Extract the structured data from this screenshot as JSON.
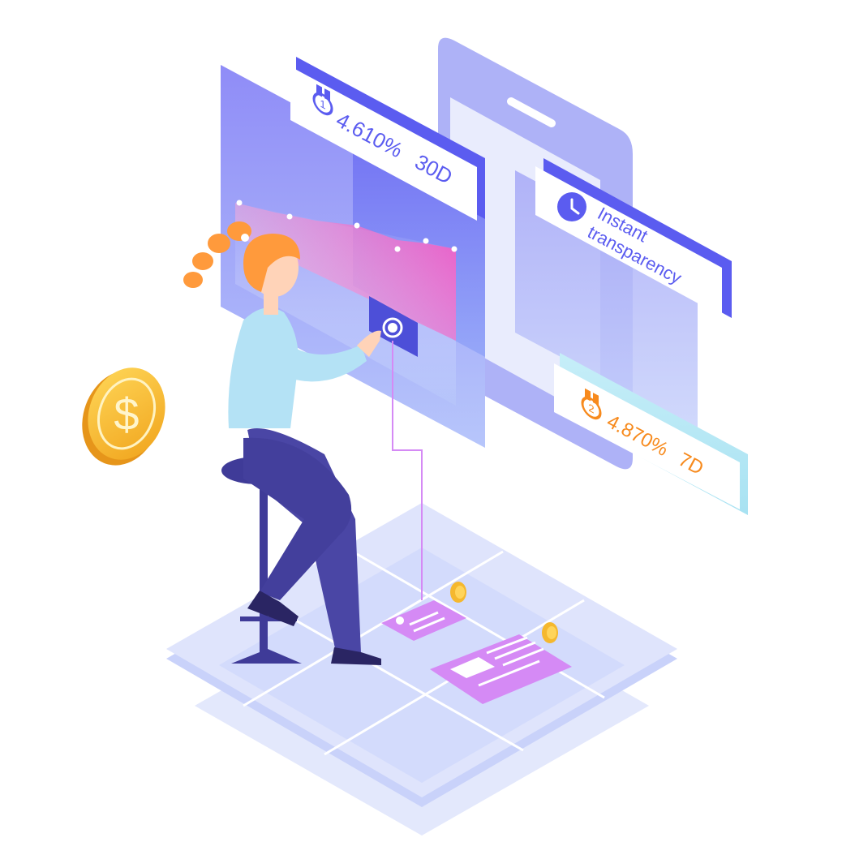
{
  "cards": {
    "rate_30d": {
      "rank": "1",
      "rate": "4.610%",
      "term": "30D"
    },
    "transparency": {
      "line1": "Instant",
      "line2": "transparency"
    },
    "rate_7d": {
      "rank": "2",
      "rate": "4.870%",
      "term": "7D"
    }
  },
  "coin": {
    "symbol": "$"
  },
  "colors": {
    "primary_purple": "#5b5cf0",
    "orange": "#f78a1d",
    "skin": "#ffd3b8",
    "hair": "#ff9a3c",
    "sweater": "#a9dcf2",
    "pants": "#4a46a5",
    "coin_gold": "#f5b82e",
    "tile": "#dde2fb"
  },
  "icons": [
    "medal-icon",
    "clock-icon",
    "dollar-coin-icon",
    "small-coin-icon"
  ]
}
